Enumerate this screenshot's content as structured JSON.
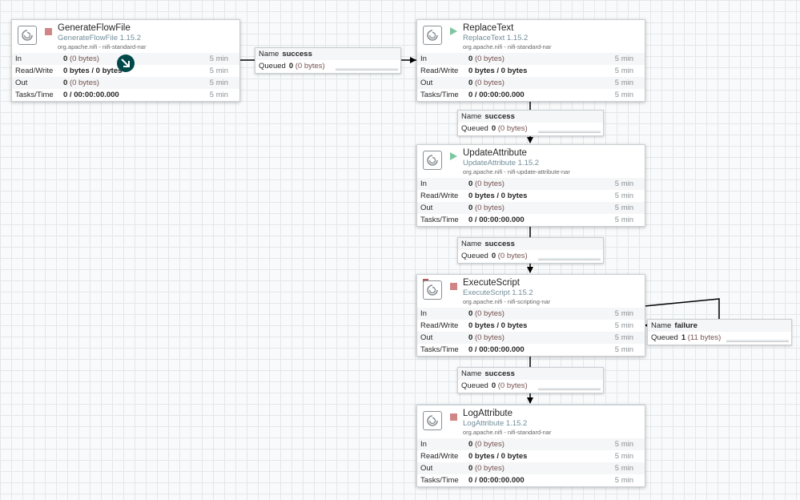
{
  "processors": [
    {
      "name": "GenerateFlowFile",
      "type": "GenerateFlowFile 1.15.2",
      "bundle": "org.apache.nifi - nifi-standard-nar",
      "state": "stopped",
      "invalid": false,
      "stats": [
        {
          "label": "In",
          "value": "0",
          "sub": "(0 bytes)",
          "time": "5 min"
        },
        {
          "label": "Read/Write",
          "value": "0 bytes / 0 bytes",
          "sub": "",
          "time": "5 min"
        },
        {
          "label": "Out",
          "value": "0",
          "sub": "(0 bytes)",
          "time": "5 min"
        },
        {
          "label": "Tasks/Time",
          "value": "0 / 00:00:00.000",
          "sub": "",
          "time": "5 min"
        }
      ]
    },
    {
      "name": "ReplaceText",
      "type": "ReplaceText 1.15.2",
      "bundle": "org.apache.nifi - nifi-standard-nar",
      "state": "running",
      "invalid": false,
      "stats": [
        {
          "label": "In",
          "value": "0",
          "sub": "(0 bytes)",
          "time": "5 min"
        },
        {
          "label": "Read/Write",
          "value": "0 bytes / 0 bytes",
          "sub": "",
          "time": "5 min"
        },
        {
          "label": "Out",
          "value": "0",
          "sub": "(0 bytes)",
          "time": "5 min"
        },
        {
          "label": "Tasks/Time",
          "value": "0 / 00:00:00.000",
          "sub": "",
          "time": "5 min"
        }
      ]
    },
    {
      "name": "UpdateAttribute",
      "type": "UpdateAttribute 1.15.2",
      "bundle": "org.apache.nifi - nifi-update-attribute-nar",
      "state": "running",
      "invalid": false,
      "stats": [
        {
          "label": "In",
          "value": "0",
          "sub": "(0 bytes)",
          "time": "5 min"
        },
        {
          "label": "Read/Write",
          "value": "0 bytes / 0 bytes",
          "sub": "",
          "time": "5 min"
        },
        {
          "label": "Out",
          "value": "0",
          "sub": "(0 bytes)",
          "time": "5 min"
        },
        {
          "label": "Tasks/Time",
          "value": "0 / 00:00:00.000",
          "sub": "",
          "time": "5 min"
        }
      ]
    },
    {
      "name": "ExecuteScript",
      "type": "ExecuteScript 1.15.2",
      "bundle": "org.apache.nifi - nifi-scripting-nar",
      "state": "stopped",
      "invalid": true,
      "stats": [
        {
          "label": "In",
          "value": "0",
          "sub": "(0 bytes)",
          "time": "5 min"
        },
        {
          "label": "Read/Write",
          "value": "0 bytes / 0 bytes",
          "sub": "",
          "time": "5 min"
        },
        {
          "label": "Out",
          "value": "0",
          "sub": "(0 bytes)",
          "time": "5 min"
        },
        {
          "label": "Tasks/Time",
          "value": "0 / 00:00:00.000",
          "sub": "",
          "time": "5 min"
        }
      ]
    },
    {
      "name": "LogAttribute",
      "type": "LogAttribute 1.15.2",
      "bundle": "org.apache.nifi - nifi-standard-nar",
      "state": "stopped",
      "invalid": false,
      "stats": [
        {
          "label": "In",
          "value": "0",
          "sub": "(0 bytes)",
          "time": "5 min"
        },
        {
          "label": "Read/Write",
          "value": "0 bytes / 0 bytes",
          "sub": "",
          "time": "5 min"
        },
        {
          "label": "Out",
          "value": "0",
          "sub": "(0 bytes)",
          "time": "5 min"
        },
        {
          "label": "Tasks/Time",
          "value": "0 / 00:00:00.000",
          "sub": "",
          "time": "5 min"
        }
      ]
    }
  ],
  "connections": [
    {
      "name_label": "Name",
      "name": "success",
      "queued_label": "Queued",
      "queued": "0",
      "queued_sub": "(0 bytes)"
    },
    {
      "name_label": "Name",
      "name": "success",
      "queued_label": "Queued",
      "queued": "0",
      "queued_sub": "(0 bytes)"
    },
    {
      "name_label": "Name",
      "name": "success",
      "queued_label": "Queued",
      "queued": "0",
      "queued_sub": "(0 bytes)"
    },
    {
      "name_label": "Name",
      "name": "failure",
      "queued_label": "Queued",
      "queued": "1",
      "queued_sub": "(11 bytes)"
    },
    {
      "name_label": "Name",
      "name": "success",
      "queued_label": "Queued",
      "queued": "0",
      "queued_sub": "(0 bytes)"
    }
  ],
  "colors": {
    "stopped": "#d18686",
    "running": "#7dc7a0",
    "badge": "#004849",
    "type_text": "#728e9b"
  },
  "icons": {
    "processor": "processor-icon",
    "badge": "arrow-down-right-icon",
    "invalid": "warning-shield-icon"
  }
}
